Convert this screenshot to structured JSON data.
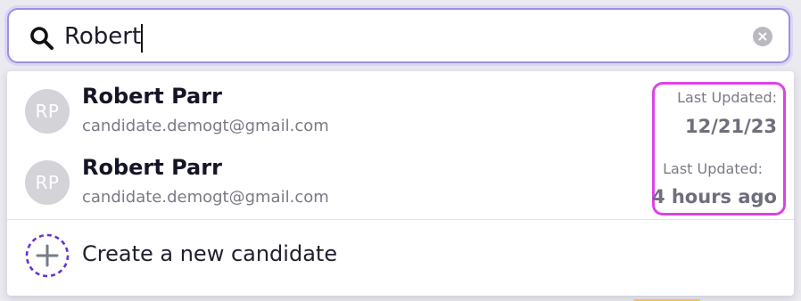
{
  "search": {
    "value": "Robert",
    "placeholder": ""
  },
  "results": [
    {
      "initials": "RP",
      "name": "Robert Parr",
      "email": "candidate.demogt@gmail.com",
      "updated_label": "Last Updated:",
      "updated_value": "12/21/23"
    },
    {
      "initials": "RP",
      "name": "Robert Parr",
      "email": "candidate.demogt@gmail.com",
      "updated_label": "Last Updated:",
      "updated_value": "4 hours ago"
    }
  ],
  "create": {
    "label": "Create a new candidate"
  },
  "icons": {
    "search": "search-icon",
    "clear": "clear-icon",
    "plus": "plus-icon"
  },
  "colors": {
    "focus_border": "#9c91dd",
    "highlight_box": "#dc43e6",
    "plus_dash": "#6a2fd6",
    "avatar_bg": "#d3d3d8",
    "name_text": "#151526",
    "meta_text": "#7a7a86"
  }
}
